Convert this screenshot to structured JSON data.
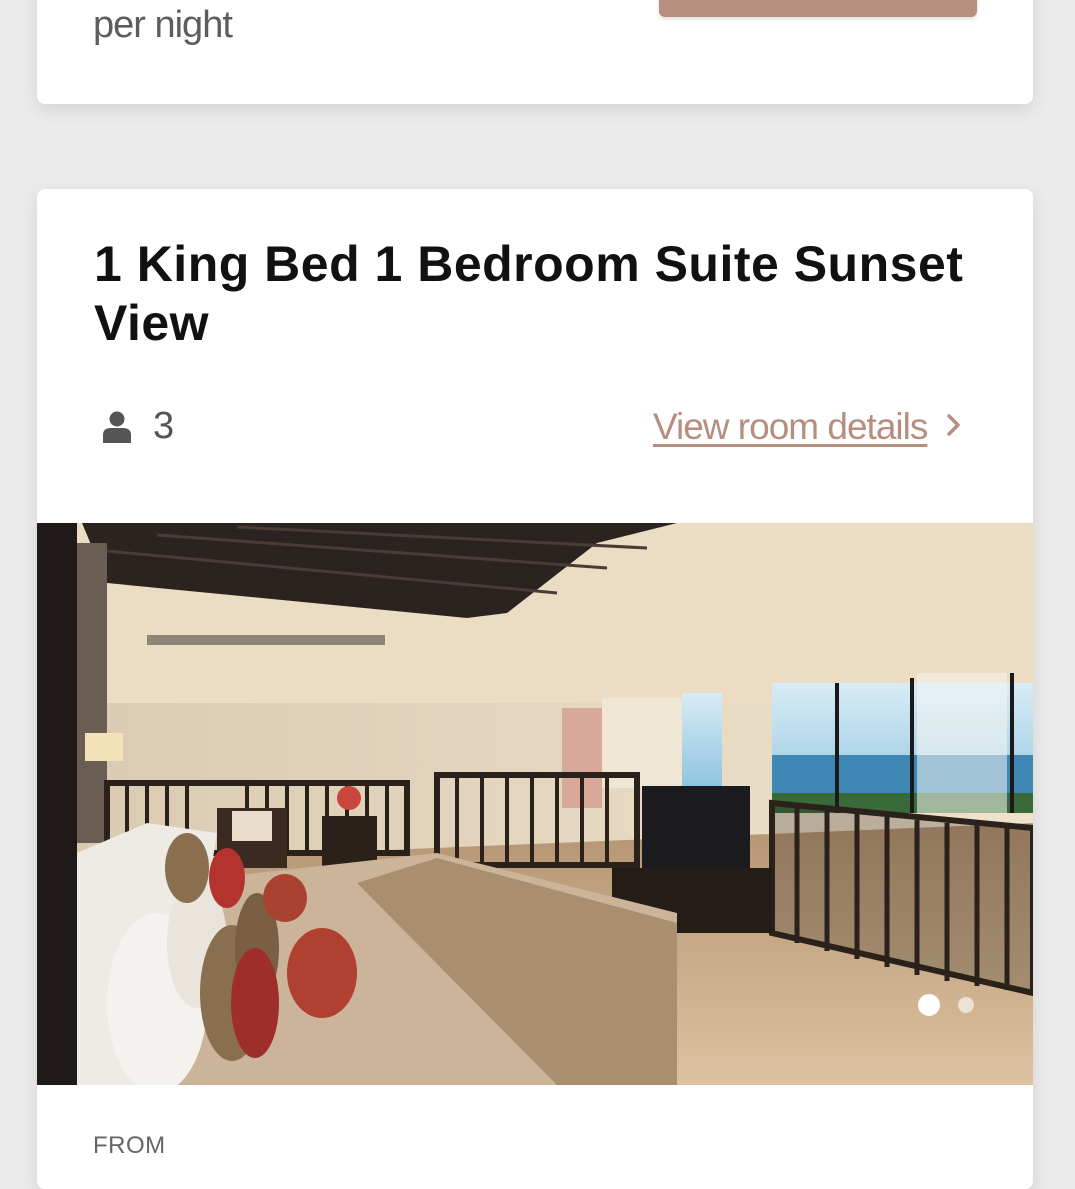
{
  "previous_card": {
    "price_unit": "per night",
    "colors": {
      "button": "#b58e7e",
      "text": "#5d5d5d"
    }
  },
  "room": {
    "title": "1 King Bed 1 Bedroom Suite Sunset View",
    "guests": "3",
    "guest_icon": "person-icon",
    "details_link": "View room details",
    "details_icon": "chevron-right-icon",
    "carousel": {
      "slide_count": 2,
      "active_index": 0
    },
    "price_label": "FROM",
    "colors": {
      "accent": "#b58e7e",
      "title": "#111111",
      "muted": "#555555"
    }
  }
}
